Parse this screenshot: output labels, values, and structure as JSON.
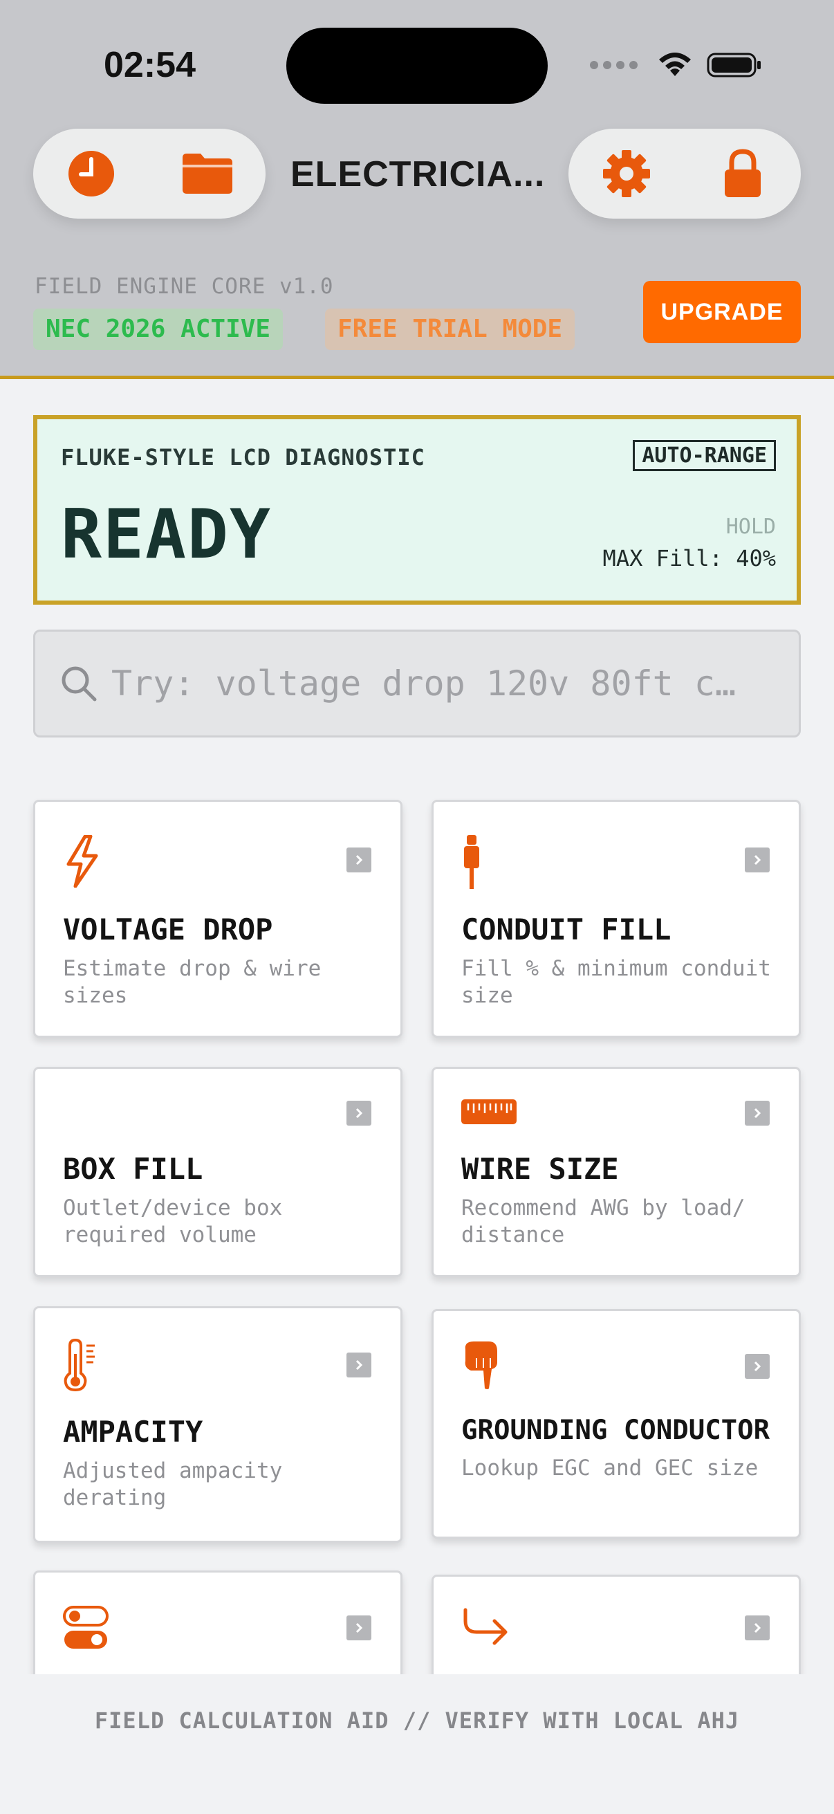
{
  "status_bar": {
    "time": "02:54"
  },
  "header": {
    "app_title": "ELECTRICIA...",
    "engine_label": "FIELD ENGINE CORE v1.0",
    "badges": {
      "nec": "NEC 2026 ACTIVE",
      "trial": "FREE TRIAL MODE"
    },
    "upgrade_label": "UPGRADE",
    "left_icons": [
      "clock-icon",
      "folder-icon"
    ],
    "right_icons": [
      "gear-icon",
      "lock-icon"
    ],
    "accent_color": "#E8590C"
  },
  "lcd": {
    "title": "FLUKE-STYLE LCD DIAGNOSTIC",
    "range": "AUTO-RANGE",
    "value": "READY",
    "hold": "HOLD",
    "max_fill": "MAX Fill: 40%"
  },
  "search": {
    "placeholder": "Try: voltage drop 120v 80ft c…"
  },
  "cards": [
    {
      "title": "VOLTAGE DROP",
      "desc": "Estimate drop & wire sizes",
      "icon": "lightning-icon"
    },
    {
      "title": "CONDUIT FILL",
      "desc": "Fill % & minimum conduit size",
      "icon": "plug-icon"
    },
    {
      "title": "BOX FILL",
      "desc": "Outlet/device box required volume",
      "icon": ""
    },
    {
      "title": "WIRE SIZE",
      "desc": "Recommend AWG by load/ distance",
      "icon": "ruler-icon"
    },
    {
      "title": "AMPACITY",
      "desc": "Adjusted ampacity derating",
      "icon": "thermometer-icon"
    },
    {
      "title": "GROUNDING CONDUCTOR",
      "desc": "Lookup EGC and GEC size",
      "icon": "pointing-hand-icon"
    },
    {
      "title": "",
      "desc": "",
      "icon": "toggle-icon"
    },
    {
      "title": "",
      "desc": "",
      "icon": "arrow-turn-icon"
    }
  ],
  "footer": {
    "text": "FIELD CALCULATION AID // VERIFY WITH LOCAL AHJ"
  }
}
